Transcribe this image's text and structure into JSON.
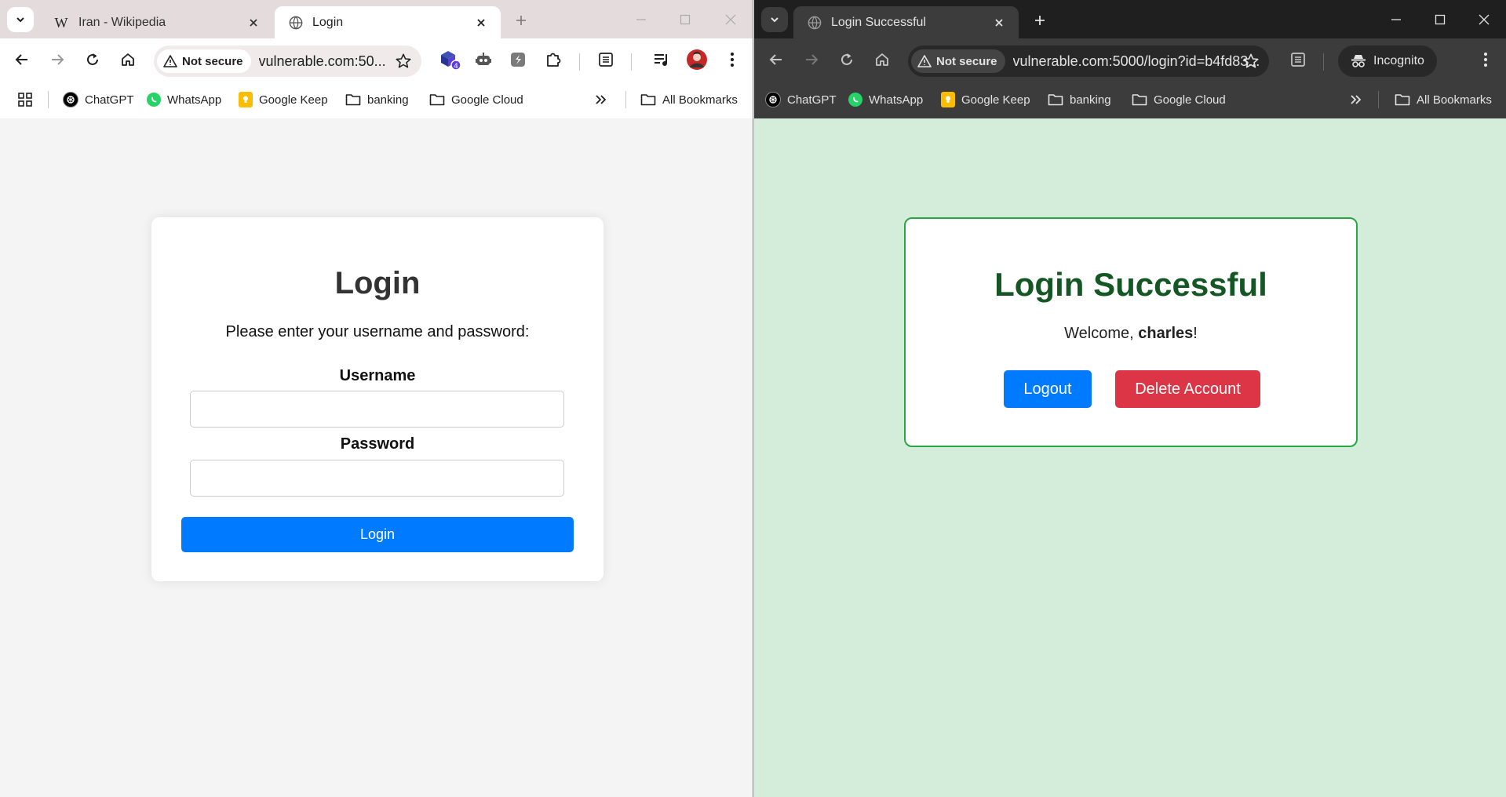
{
  "left_window": {
    "tabs": [
      {
        "title": "Iran - Wikipedia",
        "favicon": "W"
      },
      {
        "title": "Login",
        "active": true
      }
    ],
    "omnibox": {
      "security_label": "Not secure",
      "url": "vulnerable.com:50..."
    },
    "extension_badge": "4",
    "bookmarks": [
      {
        "label": "ChatGPT",
        "icon": "chatgpt-icon"
      },
      {
        "label": "WhatsApp",
        "icon": "whatsapp-icon"
      },
      {
        "label": "Google Keep",
        "icon": "google-keep-icon"
      },
      {
        "label": "banking",
        "icon": "folder-icon"
      },
      {
        "label": "Google Cloud",
        "icon": "folder-icon"
      },
      {
        "label": "All Bookmarks",
        "icon": "folder-icon"
      }
    ],
    "page": {
      "title": "Login",
      "intro": "Please enter your username and password:",
      "username_label": "Username",
      "username_value": "",
      "password_label": "Password",
      "password_value": "",
      "submit_label": "Login"
    }
  },
  "right_window": {
    "tabs": [
      {
        "title": "Login Successful",
        "active": true
      }
    ],
    "omnibox": {
      "security_label": "Not secure",
      "url": "vulnerable.com:5000/login?id=b4fd83..."
    },
    "incognito_label": "Incognito",
    "bookmarks": [
      {
        "label": "ChatGPT",
        "icon": "chatgpt-icon"
      },
      {
        "label": "WhatsApp",
        "icon": "whatsapp-icon"
      },
      {
        "label": "Google Keep",
        "icon": "google-keep-icon"
      },
      {
        "label": "banking",
        "icon": "folder-icon"
      },
      {
        "label": "Google Cloud",
        "icon": "folder-icon"
      },
      {
        "label": "All Bookmarks",
        "icon": "folder-icon"
      }
    ],
    "page": {
      "title": "Login Successful",
      "welcome_prefix": "Welcome, ",
      "username": "charles",
      "welcome_suffix": "!",
      "logout_label": "Logout",
      "delete_label": "Delete Account"
    }
  },
  "colors": {
    "primary_blue": "#007bff",
    "danger_red": "#dc3545",
    "success_green": "#28a745",
    "success_text": "#155724",
    "success_bg": "#d4edda",
    "avatar_red": "#c62828",
    "extension_purple": "#5b3fd6"
  }
}
